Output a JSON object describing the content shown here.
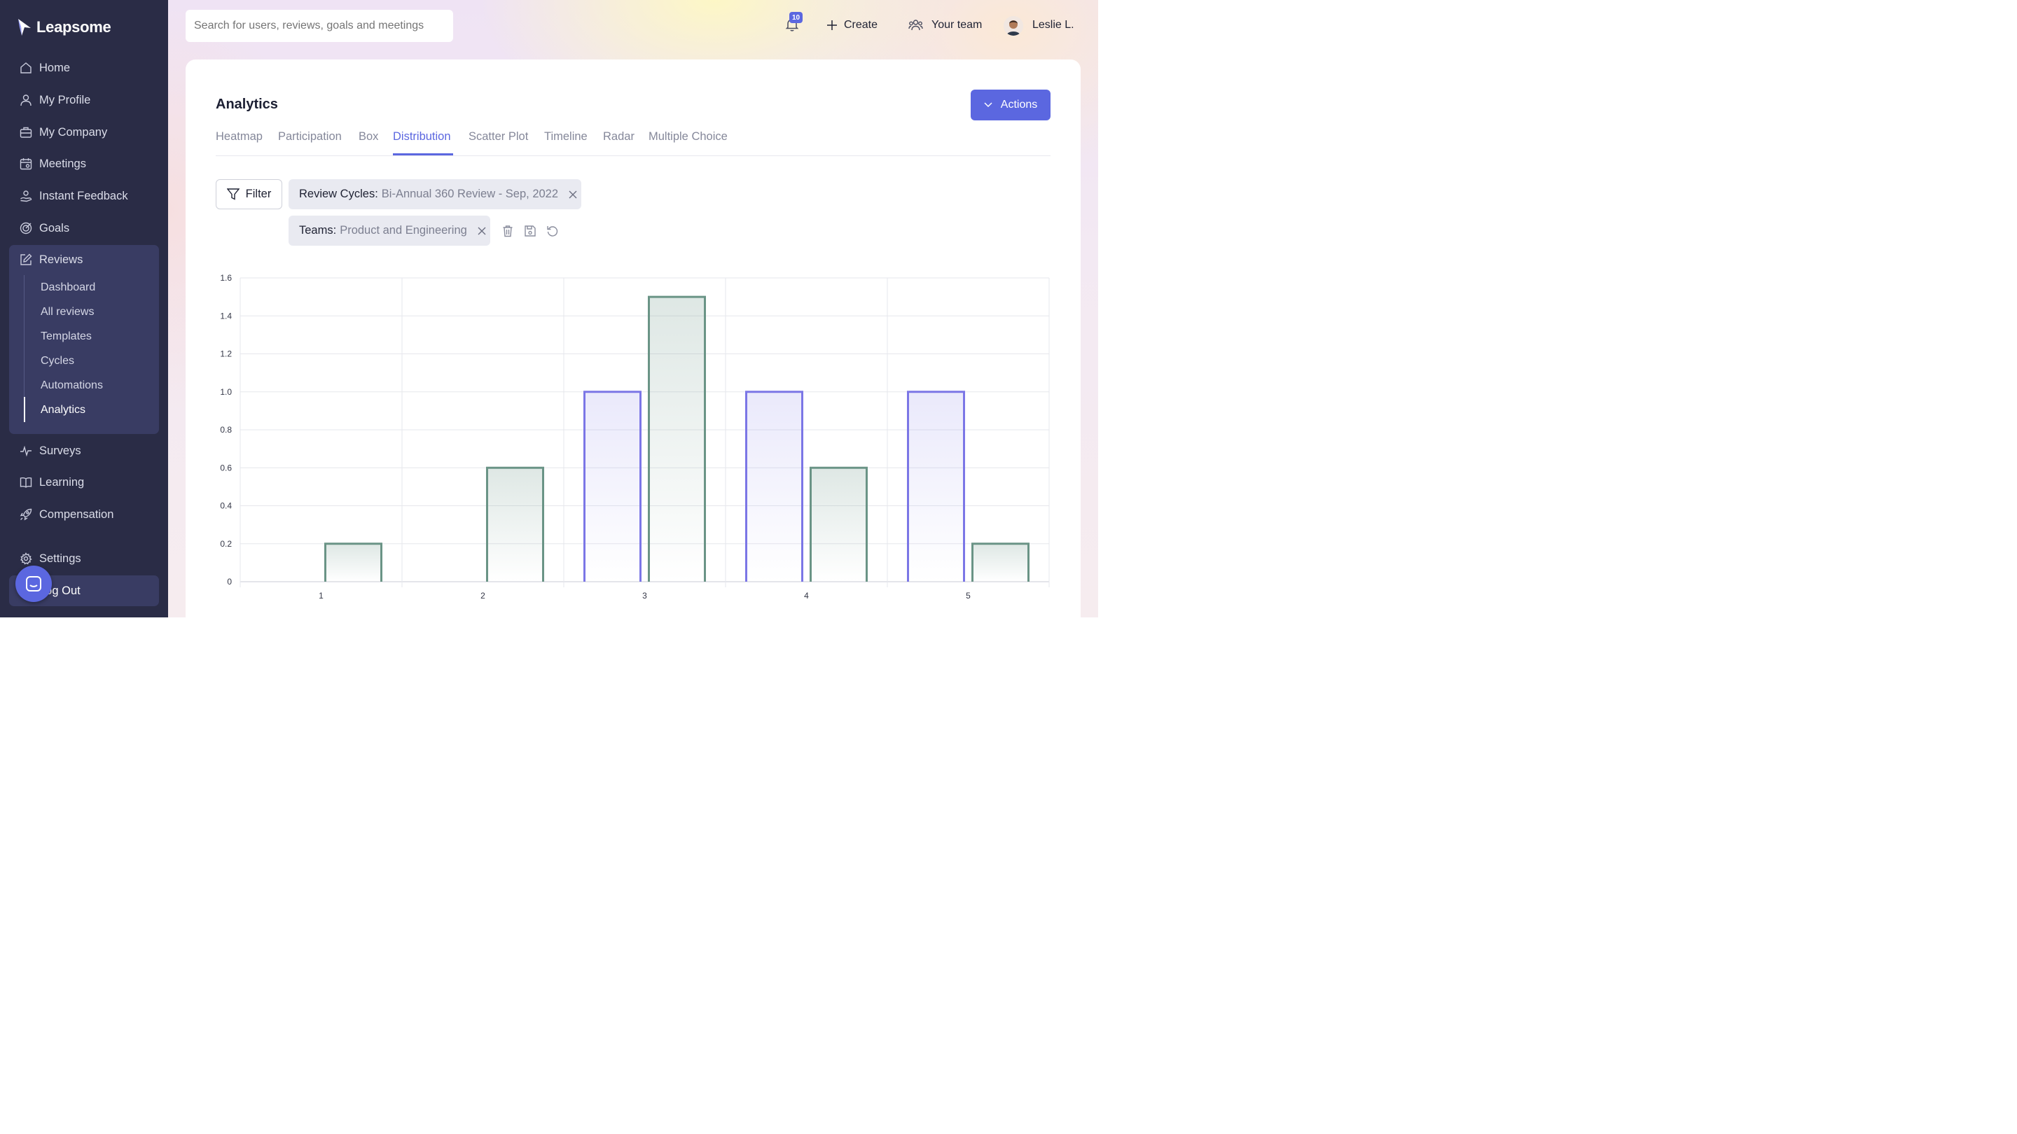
{
  "app": {
    "name": "Leapsome"
  },
  "sidebar": {
    "items": [
      {
        "label": "Home",
        "icon": "home-icon"
      },
      {
        "label": "My Profile",
        "icon": "user-icon"
      },
      {
        "label": "My Company",
        "icon": "briefcase-icon"
      },
      {
        "label": "Meetings",
        "icon": "calendar-icon"
      },
      {
        "label": "Instant Feedback",
        "icon": "feedback-icon"
      },
      {
        "label": "Goals",
        "icon": "target-icon"
      },
      {
        "label": "Reviews",
        "icon": "edit-icon"
      },
      {
        "label": "Surveys",
        "icon": "pulse-icon"
      },
      {
        "label": "Learning",
        "icon": "book-icon"
      },
      {
        "label": "Compensation",
        "icon": "rocket-icon"
      },
      {
        "label": "Settings",
        "icon": "gear-icon"
      },
      {
        "label": "Log Out",
        "icon": "logout-icon"
      }
    ],
    "reviews_sub": [
      {
        "label": "Dashboard"
      },
      {
        "label": "All reviews"
      },
      {
        "label": "Templates"
      },
      {
        "label": "Cycles"
      },
      {
        "label": "Automations"
      },
      {
        "label": "Analytics",
        "active": true
      }
    ]
  },
  "topbar": {
    "search_placeholder": "Search for users, reviews, goals and meetings",
    "notification_count": "10",
    "create_label": "Create",
    "team_label": "Your team",
    "user_name": "Leslie L."
  },
  "page": {
    "title": "Analytics",
    "actions_label": "Actions",
    "tabs": [
      {
        "label": "Heatmap"
      },
      {
        "label": "Participation"
      },
      {
        "label": "Box"
      },
      {
        "label": "Distribution",
        "active": true
      },
      {
        "label": "Scatter Plot"
      },
      {
        "label": "Timeline"
      },
      {
        "label": "Radar"
      },
      {
        "label": "Multiple Choice"
      }
    ],
    "filter_label": "Filter",
    "filters": [
      {
        "key": "Review Cycles:",
        "value": "Bi-Annual 360 Review - Sep, 2022"
      },
      {
        "key": "Teams:",
        "value": "Product and Engineering"
      }
    ]
  },
  "colors": {
    "accent": "#5b67e0",
    "series_a": "#7b76e6",
    "series_b": "#6a9486",
    "sidebar_bg": "#2a2c46"
  },
  "chart_data": {
    "type": "bar",
    "categories": [
      "1",
      "2",
      "3",
      "4",
      "5"
    ],
    "series": [
      {
        "values": [
          0,
          0,
          1.0,
          1.0,
          1.0
        ]
      },
      {
        "values": [
          0.2,
          0.6,
          1.5,
          0.6,
          0.2
        ]
      }
    ],
    "ylim": [
      0,
      1.6
    ],
    "yticks": [
      "0",
      "0.2",
      "0.4",
      "0.6",
      "0.8",
      "1.0",
      "1.2",
      "1.4",
      "1.6"
    ],
    "grid": true,
    "legend": "none"
  }
}
